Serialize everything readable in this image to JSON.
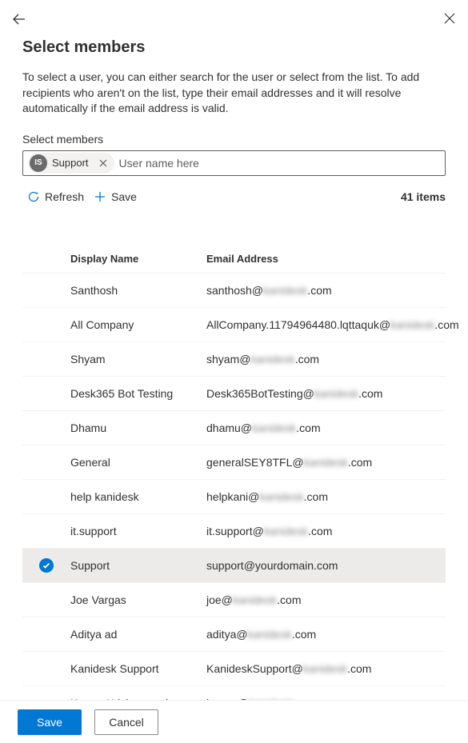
{
  "header": {
    "title": "Select members",
    "description": "To select a user, you can either search for the user or select from the list. To add recipients who aren't on the list, type their email addresses and it will resolve automatically if the email address is valid."
  },
  "picker": {
    "label": "Select members",
    "placeholder": "User name here",
    "chip": {
      "initials": "IS",
      "label": "Support"
    }
  },
  "actions": {
    "refresh": "Refresh",
    "save": "Save",
    "count": "41 items"
  },
  "columns": {
    "name": "Display Name",
    "email": "Email Address"
  },
  "hidden_domain": "kanidesk",
  "rows": [
    {
      "name": "Santhosh",
      "email_prefix": "santhosh@",
      "email_suffix": ".com",
      "selected": false
    },
    {
      "name": "All Company",
      "email_prefix": "AllCompany.11794964480.lqttaquk@",
      "email_suffix": ".com",
      "selected": false
    },
    {
      "name": "Shyam",
      "email_prefix": "shyam@",
      "email_suffix": ".com",
      "selected": false
    },
    {
      "name": "Desk365 Bot Testing",
      "email_prefix": "Desk365BotTesting@",
      "email_suffix": ".com",
      "selected": false
    },
    {
      "name": "Dhamu",
      "email_prefix": "dhamu@",
      "email_suffix": ".com",
      "selected": false
    },
    {
      "name": "General",
      "email_prefix": "generalSEY8TFL@",
      "email_suffix": ".com",
      "selected": false
    },
    {
      "name": "help kanidesk",
      "email_prefix": "helpkani@",
      "email_suffix": ".com",
      "selected": false
    },
    {
      "name": "it.support",
      "email_prefix": "it.support@",
      "email_suffix": ".com",
      "selected": false
    },
    {
      "name": "Support",
      "email_prefix": "support@yourdomain.com",
      "email_suffix": "",
      "selected": true,
      "plain": true
    },
    {
      "name": "Joe Vargas",
      "email_prefix": "joe@",
      "email_suffix": ".com",
      "selected": false
    },
    {
      "name": "Aditya ad",
      "email_prefix": "aditya@",
      "email_suffix": ".com",
      "selected": false
    },
    {
      "name": "Kanidesk Support",
      "email_prefix": "KanideskSupport@",
      "email_suffix": ".com",
      "selected": false
    },
    {
      "name": "Kumar Krishnasami",
      "email_prefix": "kumar@",
      "email_suffix": ".com",
      "selected": false
    }
  ],
  "footer": {
    "save": "Save",
    "cancel": "Cancel"
  }
}
